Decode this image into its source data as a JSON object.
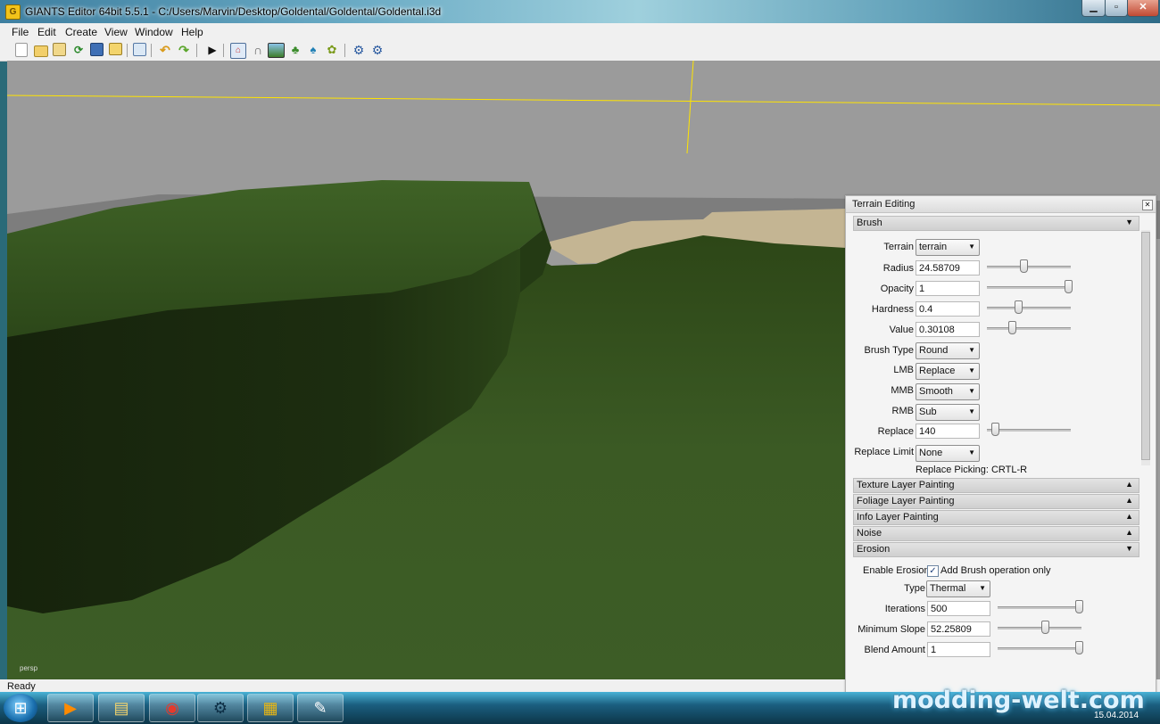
{
  "window": {
    "title": "GIANTS Editor 64bit 5.5.1 - C:/Users/Marvin/Desktop/Goldental/Goldental/Goldental.i3d",
    "app_icon_glyph": "G",
    "min_glyph": "▁",
    "max_glyph": "▫",
    "close_glyph": "✕"
  },
  "menu": [
    "File",
    "Edit",
    "Create",
    "View",
    "Window",
    "Help"
  ],
  "toolbar_icons": [
    "new-file-icon",
    "open-folder-icon",
    "edit-icon",
    "refresh-icon",
    "save-icon",
    "export-icon",
    "reload-icon",
    "undo-icon",
    "redo-icon",
    "play-icon",
    "select-icon",
    "snap-icon",
    "terrain-sculpt-icon",
    "paint-icon",
    "foliage-icon",
    "settings-icon",
    "settings-alt-icon"
  ],
  "viewport": {
    "label": "persp"
  },
  "status": {
    "text": "Ready"
  },
  "panel": {
    "title": "Terrain Editing",
    "close_glyph": "✕",
    "brush_section": "Brush",
    "expanded_arrow": "▼",
    "collapsed_arrow": "▲",
    "terrain_label": "Terrain",
    "terrain_value": "terrain",
    "radius_label": "Radius",
    "radius_value": "24.58709",
    "radius_level": 0.44,
    "opacity_label": "Opacity",
    "opacity_value": "1",
    "opacity_level": 0.97,
    "hardness_label": "Hardness",
    "hardness_value": "0.4",
    "hardness_level": 0.37,
    "value_label": "Value",
    "value_value": "0.30108",
    "value_level": 0.3,
    "brush_type_label": "Brush Type",
    "brush_type_value": "Round",
    "lmb_label": "LMB",
    "lmb_value": "Replace",
    "mmb_label": "MMB",
    "mmb_value": "Smooth",
    "rmb_label": "RMB",
    "rmb_value": "Sub",
    "replace_label": "Replace",
    "replace_value": "140",
    "replace_level": 0.1,
    "replace_limit_label": "Replace Limit",
    "replace_limit_value": "None",
    "replace_picking": "Replace Picking: CRTL-R",
    "sections": [
      "Texture Layer Painting",
      "Foliage Layer Painting",
      "Info Layer Painting",
      "Noise"
    ],
    "erosion_section": "Erosion",
    "enable_erosion_label": "Enable Erosion",
    "add_brush_label": "Add Brush operation only",
    "add_brush_checked": true,
    "type_label": "Type",
    "type_value": "Thermal",
    "iterations_label": "Iterations",
    "iterations_value": "500",
    "iterations_level": 0.97,
    "min_slope_label": "Minimum Slope",
    "min_slope_value": "52.25809",
    "min_slope_level": 0.56,
    "blend_label": "Blend Amount",
    "blend_value": "1",
    "blend_level": 0.97
  },
  "taskbar": {
    "start_glyph": "⊞",
    "apps": [
      "media-player-icon",
      "file-explorer-icon",
      "chrome-icon",
      "steam-icon",
      "giants-editor-icon",
      "paint-app-icon"
    ],
    "app_glyphs": [
      "▶",
      "▤",
      "◉",
      "⚙",
      "▦",
      "✎"
    ],
    "watermark": "modding-welt.com",
    "date": "15.04.2014"
  },
  "colors": {
    "accent_yellow": "#ffe400",
    "grass": "#36521f",
    "sky_grey": "#9b9b9b"
  }
}
